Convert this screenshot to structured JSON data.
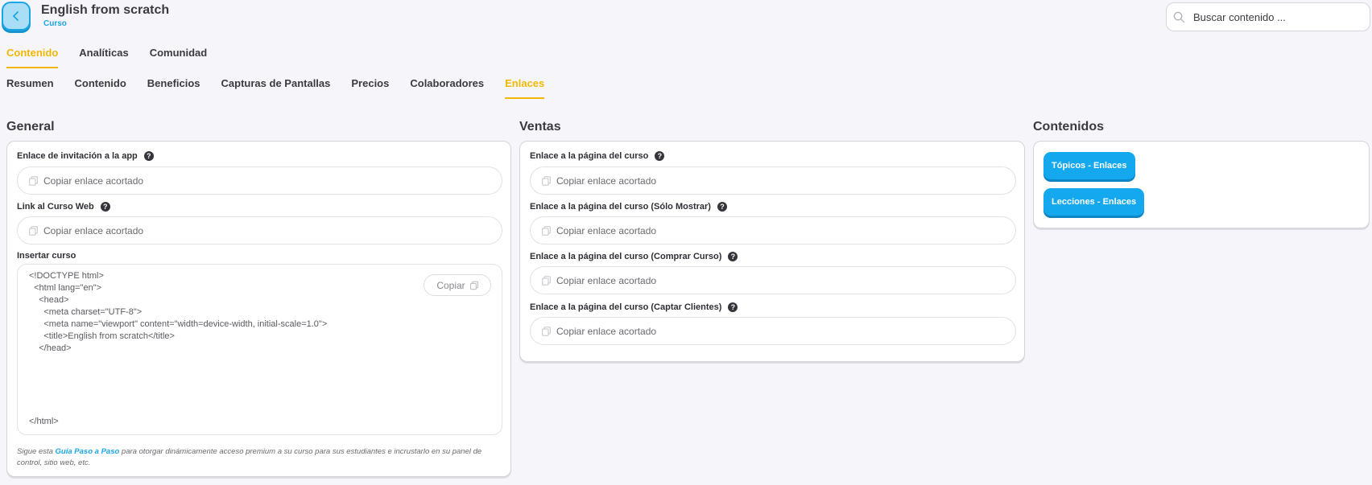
{
  "header": {
    "title": "English from scratch",
    "subtitle": "Curso",
    "search_placeholder": "Buscar contenido ..."
  },
  "main_tabs": [
    {
      "label": "Contenido",
      "active": true
    },
    {
      "label": "Analíticas",
      "active": false
    },
    {
      "label": "Comunidad",
      "active": false
    }
  ],
  "sub_tabs": [
    {
      "label": "Resumen",
      "active": false
    },
    {
      "label": "Contenido",
      "active": false
    },
    {
      "label": "Beneficios",
      "active": false
    },
    {
      "label": "Capturas de Pantallas",
      "active": false
    },
    {
      "label": "Precios",
      "active": false
    },
    {
      "label": "Colaboradores",
      "active": false
    },
    {
      "label": "Enlaces",
      "active": true
    }
  ],
  "general": {
    "title": "General",
    "fields": [
      {
        "label": "Enlace de invitación a la app",
        "placeholder": "Copiar enlace acortado"
      },
      {
        "label": "Link al Curso Web",
        "placeholder": "Copiar enlace acortado"
      }
    ],
    "embed": {
      "label": "Insertar curso",
      "copy_label": "Copiar",
      "code_lines": [
        "<!DOCTYPE html>",
        "  <html lang=\"en\">",
        "    <head>",
        "      <meta charset=\"UTF-8\">",
        "      <meta name=\"viewport\" content=\"width=device-width, initial-scale=1.0\">",
        "      <title>English from scratch</title>",
        "    </head>",
        "</html>"
      ]
    },
    "hint": {
      "prefix": "Sigue esta ",
      "link": "Guía Paso a Paso",
      "suffix": " para otorgar dinámicamente acceso premium a su curso para sus estudiantes e incrustarlo en su panel de control, sitio web, etc."
    }
  },
  "ventas": {
    "title": "Ventas",
    "fields": [
      {
        "label": "Enlace a la página del curso",
        "placeholder": "Copiar enlace acortado"
      },
      {
        "label": "Enlace a la página del curso (Sólo Mostrar)",
        "placeholder": "Copiar enlace acortado"
      },
      {
        "label": "Enlace a la página del curso (Comprar Curso)",
        "placeholder": "Copiar enlace acortado"
      },
      {
        "label": "Enlace a la página del curso (Captar Clientes)",
        "placeholder": "Copiar enlace acortado"
      }
    ]
  },
  "contenidos": {
    "title": "Contenidos",
    "buttons": [
      "Tópicos - Enlaces",
      "Lecciones - Enlaces"
    ]
  },
  "colors": {
    "accent_yellow": "#f2b705",
    "accent_blue": "#14a9ee"
  }
}
